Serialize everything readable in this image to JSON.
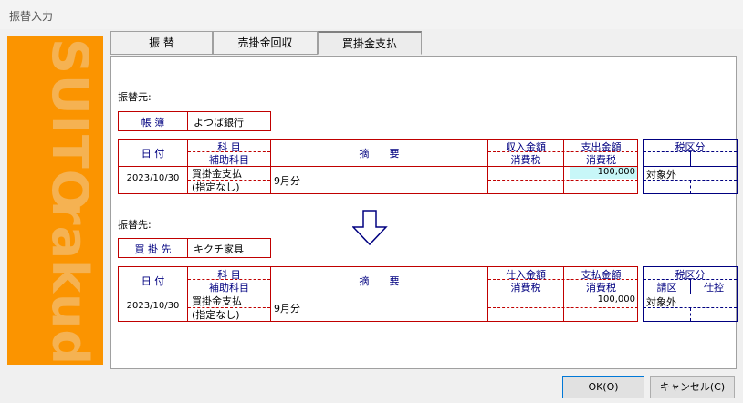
{
  "window": {
    "title": "振替入力"
  },
  "sidebar": {
    "brand_top": "SUITO",
    "brand_bottom": "rakuda"
  },
  "tabs": [
    {
      "label": "振 替",
      "selected": false
    },
    {
      "label": "売掛金回収",
      "selected": false
    },
    {
      "label": "買掛金支払",
      "selected": true
    }
  ],
  "source": {
    "section_label": "振替元:",
    "book_label": "帳 簿",
    "book_value": "よつば銀行",
    "headers": {
      "date": "日 付",
      "account": "科 目",
      "sub_account": "補助科目",
      "summary": "摘　　要",
      "amount1": "収入金額",
      "tax1": "消費税",
      "amount2": "支出金額",
      "tax2": "消費税",
      "tax_class": "税区分"
    },
    "row": {
      "date": "2023/10/30",
      "account": "買掛金支払",
      "sub_account": "(指定なし)",
      "summary": "9月分",
      "amount2": "100,000",
      "tax_class": "対象外"
    }
  },
  "arrow": {
    "icon": "down-arrow-icon"
  },
  "dest": {
    "section_label": "振替先:",
    "vendor_label": "買 掛 先",
    "vendor_value": "キクチ家具",
    "headers": {
      "date": "日 付",
      "account": "科 目",
      "sub_account": "補助科目",
      "summary": "摘　　要",
      "amount1": "仕入金額",
      "tax1": "消費税",
      "amount2": "支払金額",
      "tax2": "消費税",
      "tax_class": "税区分",
      "tax_sub1": "請区",
      "tax_sub2": "仕控"
    },
    "row": {
      "date": "2023/10/30",
      "account": "買掛金支払",
      "sub_account": "(指定なし)",
      "summary": "9月分",
      "amount2": "100,000",
      "tax_class": "対象外"
    }
  },
  "buttons": {
    "ok": "OK(O)",
    "cancel": "キャンセル(C)"
  },
  "colors": {
    "brand_orange": "#fb9400",
    "grid_red": "#c00000",
    "grid_navy": "#000080",
    "highlight_cyan": "#c8f7f8"
  }
}
